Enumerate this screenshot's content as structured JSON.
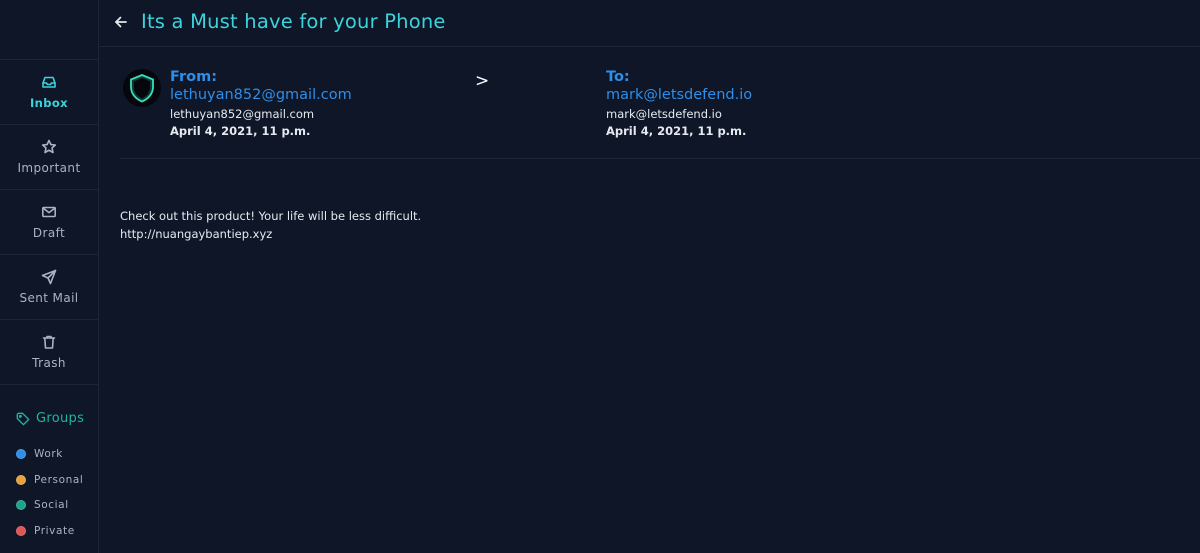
{
  "sidebar": {
    "items": [
      {
        "label": "Inbox",
        "icon": "inbox-icon",
        "active": true
      },
      {
        "label": "Important",
        "icon": "star-icon"
      },
      {
        "label": "Draft",
        "icon": "mail-icon"
      },
      {
        "label": "Sent Mail",
        "icon": "send-icon"
      },
      {
        "label": "Trash",
        "icon": "trash-icon"
      }
    ],
    "groups_label": "Groups",
    "groups": [
      {
        "label": "Work",
        "color": "#2f8ee8"
      },
      {
        "label": "Personal",
        "color": "#e6a23c"
      },
      {
        "label": "Social",
        "color": "#1fa38a"
      },
      {
        "label": "Private",
        "color": "#e25555"
      }
    ]
  },
  "header": {
    "subject": "Its a Must have for your Phone"
  },
  "email": {
    "from": {
      "heading": "From:",
      "address": "lethuyan852@gmail.com",
      "address_sub": "lethuyan852@gmail.com",
      "date": "April 4, 2021, 11 p.m."
    },
    "separator": ">",
    "to": {
      "heading": "To:",
      "address": "mark@letsdefend.io",
      "address_sub": "mark@letsdefend.io",
      "date": "April 4, 2021, 11 p.m."
    },
    "body_lines": [
      "Check out this product! Your life will be less difficult.",
      "http://nuangaybantiep.xyz"
    ]
  },
  "colors": {
    "accent": "#3bd3dc",
    "link": "#2f8ee8",
    "groups_accent": "#1fb5a0",
    "background": "#0e1627"
  }
}
